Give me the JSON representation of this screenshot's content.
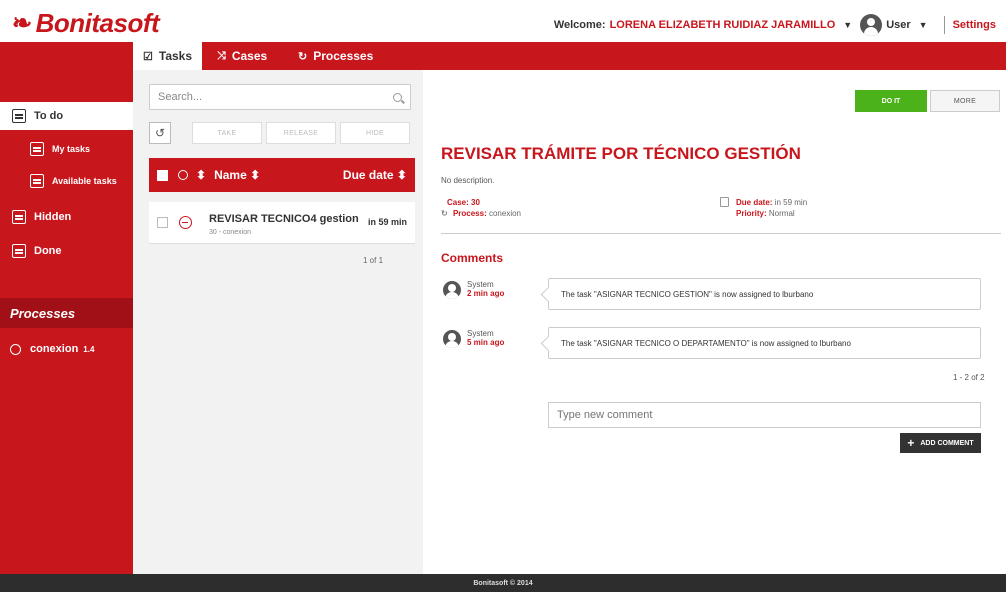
{
  "header": {
    "logo_text": "Bonitasoft",
    "welcome_label": "Welcome:",
    "user_name": "LORENA ELIZABETH RUIDIAZ JARAMILLO",
    "role": "User",
    "settings": "Settings"
  },
  "tabs": [
    {
      "label": "Tasks",
      "icon": "check-square-icon"
    },
    {
      "label": "Cases",
      "icon": "shuffle-icon"
    },
    {
      "label": "Processes",
      "icon": "process-icon"
    }
  ],
  "sidebar": {
    "items": [
      {
        "label": "To do"
      },
      {
        "label": "My tasks"
      },
      {
        "label": "Available tasks"
      },
      {
        "label": "Hidden"
      },
      {
        "label": "Done"
      }
    ],
    "processes_title": "Processes",
    "process": {
      "name": "conexion",
      "version": "1.4"
    }
  },
  "list": {
    "search_placeholder": "Search...",
    "buttons": {
      "take": "TAKE",
      "release": "RELEASE",
      "hide": "HIDE"
    },
    "columns": {
      "name": "Name ⬍",
      "due": "Due date ⬍",
      "state_sort": "⬍"
    },
    "rows": [
      {
        "name": "REVISAR TECNICO4 gestion",
        "sub": "30 - conexion",
        "due": "in 59 min"
      }
    ],
    "pager": "1 of 1"
  },
  "detail": {
    "do_it": "DO IT",
    "more": "MORE",
    "title": "REVISAR TRÁMITE POR TÉCNICO GESTIÓN",
    "description": "No description.",
    "case_label": "Case:",
    "case_value": "30",
    "process_label": "Process:",
    "process_value": "conexion",
    "due_label": "Due date:",
    "due_value": "in 59 min",
    "priority_label": "Priority:",
    "priority_value": "Normal",
    "comments_title": "Comments",
    "comments": [
      {
        "author": "System",
        "time": "2 min ago",
        "text": "The task \"ASIGNAR TECNICO GESTION\" is now assigned to lburbano"
      },
      {
        "author": "System",
        "time": "5 min ago",
        "text": "The task \"ASIGNAR TECNICO O DEPARTAMENTO\" is now assigned to lburbano"
      }
    ],
    "comments_pager": "1 - 2 of 2",
    "new_comment_placeholder": "Type new comment",
    "add_comment": "ADD COMMENT"
  },
  "footer": "Bonitasoft © 2014",
  "colors": {
    "brand": "#c8161d",
    "primary_action": "#4bb21a"
  }
}
